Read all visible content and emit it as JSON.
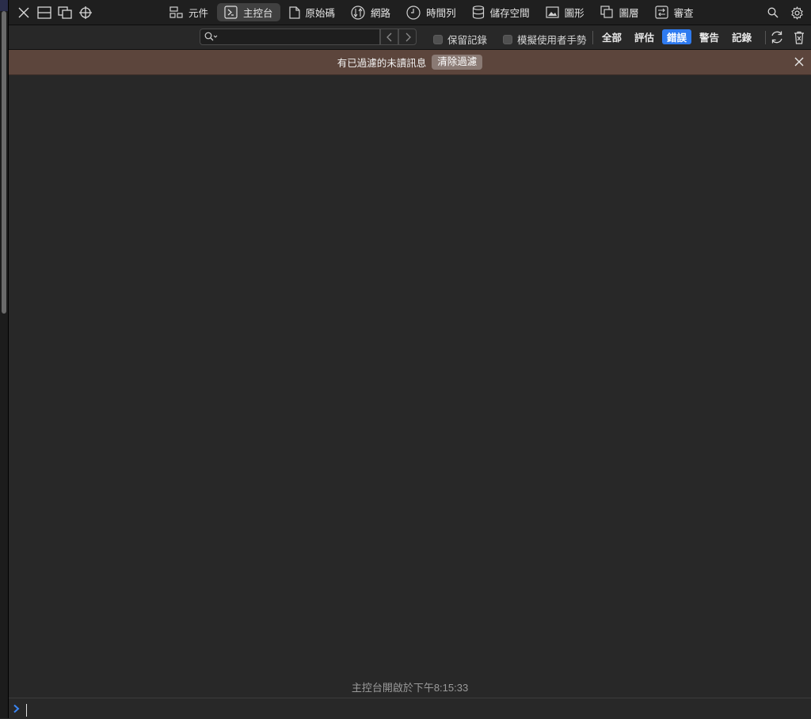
{
  "tabs": [
    {
      "label": "元件",
      "icon": "elements-icon"
    },
    {
      "label": "主控台",
      "icon": "console-icon",
      "active": true
    },
    {
      "label": "原始碼",
      "icon": "sources-icon"
    },
    {
      "label": "網路",
      "icon": "network-icon"
    },
    {
      "label": "時間列",
      "icon": "timelines-icon"
    },
    {
      "label": "儲存空間",
      "icon": "storage-icon"
    },
    {
      "label": "圖形",
      "icon": "graphics-icon"
    },
    {
      "label": "圖層",
      "icon": "layers-icon"
    },
    {
      "label": "審查",
      "icon": "audit-icon"
    }
  ],
  "filter": {
    "search_placeholder": "",
    "preserve_log": "保留記錄",
    "emulate_gesture": "模擬使用者手勢",
    "levels": [
      "全部",
      "評估",
      "錯誤",
      "警告",
      "記錄"
    ],
    "active_level": "錯誤"
  },
  "banner": {
    "message": "有已過濾的未讀訊息",
    "clear_label": "清除過濾"
  },
  "console": {
    "opened_text": "主控台開啟於下午8:15:33"
  },
  "colors": {
    "accent": "#2f7bf0",
    "banner": "#5c453c",
    "background": "#282828"
  }
}
